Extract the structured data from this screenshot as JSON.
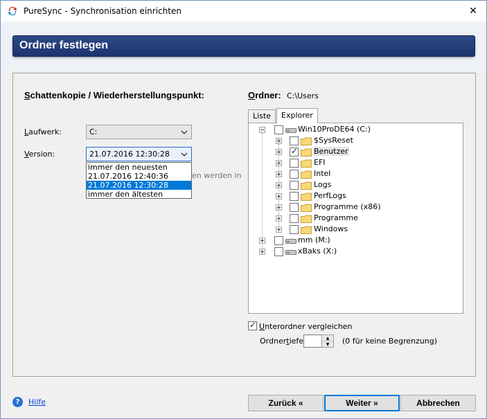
{
  "window": {
    "title": "PureSync - Synchronisation einrichten",
    "close_glyph": "✕"
  },
  "header": {
    "title": "Ordner festlegen"
  },
  "left": {
    "section_title_a": "S",
    "section_title_b": "chattenkopie / Wiederherstellungspunkt:",
    "drive_label_a": "L",
    "drive_label_b": "aufwerk:",
    "drive_value": "C:",
    "version_label_a": "V",
    "version_label_b": "ersion:",
    "version_value": "21.07.2016 12:30:28",
    "version_options": [
      "immer den neuesten",
      "21.07.2016 12:40:36",
      "21.07.2016 12:30:28",
      "immer den ältesten"
    ],
    "selected_option_index": 2,
    "obscured_text": "en werden in"
  },
  "right": {
    "folder_label_a": "O",
    "folder_label_b": "rdner:",
    "folder_path": "C:\\Users",
    "tabs": [
      {
        "label": "Liste"
      },
      {
        "label": "Explorer"
      }
    ],
    "active_tab": "Explorer",
    "tree": {
      "root": {
        "label": "Win10ProDE64 (C:)",
        "checked": false,
        "expanded": true
      },
      "children": [
        {
          "label": "$SysReset",
          "checked": false
        },
        {
          "label": "Benutzer",
          "checked": true
        },
        {
          "label": "EFI",
          "checked": false
        },
        {
          "label": "Intel",
          "checked": false
        },
        {
          "label": "Logs",
          "checked": false
        },
        {
          "label": "PerfLogs",
          "checked": false
        },
        {
          "label": "Programme (x86)",
          "checked": false
        },
        {
          "label": "Programme",
          "checked": false
        },
        {
          "label": "Windows",
          "checked": false
        }
      ],
      "drives": [
        {
          "label": "mm (M:)",
          "checked": false
        },
        {
          "label": "xBaks (X:)",
          "checked": false
        }
      ]
    },
    "subfolders_label_a": "U",
    "subfolders_label_b": "nterordner vergleichen",
    "subfolders_checked": true,
    "depth_label_a": "Ordner",
    "depth_label_b": "t",
    "depth_label_c": "iefe:",
    "depth_value": "",
    "depth_hint": "(0 für keine Begrenzung)"
  },
  "footer": {
    "help_label": "Hilfe",
    "back_label": "Zurück «",
    "next_label": "Weiter »",
    "cancel_label": "Abbrechen"
  },
  "colors": {
    "header_bar": "#1f3a78",
    "selection": "#0078d7",
    "link": "#0046d5"
  }
}
